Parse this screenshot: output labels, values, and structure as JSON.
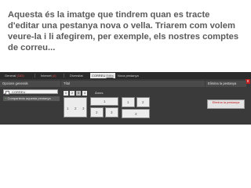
{
  "caption": "Aquesta és la imatge que tindrem quan es tracte d'editar una pestanya nova o vella. Triarem com volem veure-la i li afegirem, per exemple, els nostres comptes de correu...",
  "tabs": [
    {
      "label": "General",
      "count": "(183)"
    },
    {
      "label": "Internet",
      "count": "(4)"
    },
    {
      "label": "Diversitat",
      "count": ""
    },
    {
      "label": "CORREU",
      "edit": "Edita"
    },
    {
      "label": "Nova pestanya",
      "count": ""
    }
  ],
  "close": "x",
  "options": {
    "header": "Opcions generals",
    "field_value": "CORREU",
    "share_label": "Compartexis aquesta pestanya"
  },
  "title": {
    "header": "Títol",
    "number_buttons": [
      "1",
      "2",
      "3",
      "4"
    ],
    "files_label": "Àrees"
  },
  "layouts": {
    "a": [
      "1",
      "2",
      "3"
    ],
    "b_top": "1",
    "b_bottom": [
      "2",
      "3"
    ],
    "c": [
      "1",
      "2"
    ],
    "c_bottom": "3"
  },
  "delete": {
    "header": "Elimina la pestanya",
    "button": "Elimina la pestanya"
  }
}
